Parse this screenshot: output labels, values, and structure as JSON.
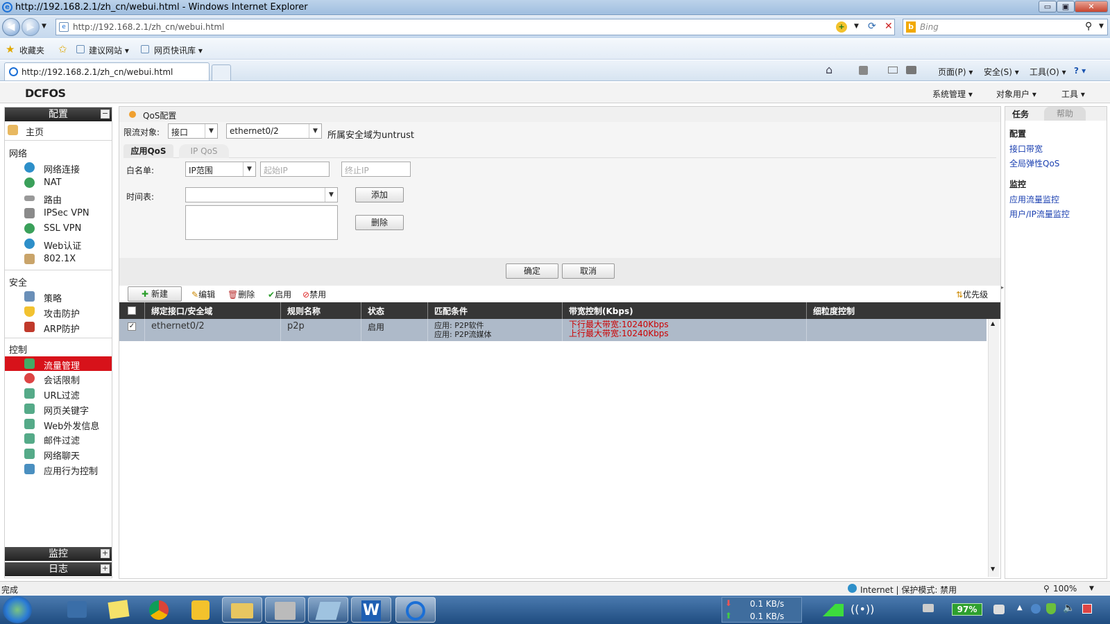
{
  "window": {
    "title": "http://192.168.2.1/zh_cn/webui.html - Windows Internet Explorer",
    "min": "▭",
    "max": "▣",
    "close": "✕"
  },
  "browser": {
    "url": "http://192.168.2.1/zh_cn/webui.html",
    "search_placeholder": "Bing",
    "favorites_label": "收藏夹",
    "fav_links": [
      "建议网站 ▾",
      "网页快讯库 ▾"
    ],
    "tab_title": "http://192.168.2.1/zh_cn/webui.html",
    "commands": [
      "页面(P) ▾",
      "安全(S) ▾",
      "工具(O) ▾",
      "? ▾"
    ]
  },
  "app": {
    "logo": "DCFOS",
    "menus": [
      "系统管理 ▾",
      "对象用户 ▾",
      "工具 ▾"
    ]
  },
  "sidebar": {
    "config_header": "配置",
    "home": "主页",
    "sections": [
      {
        "title": "网络",
        "items": [
          "网络连接",
          "NAT",
          "路由",
          "IPSec VPN",
          "SSL VPN",
          "Web认证",
          "802.1X"
        ]
      },
      {
        "title": "安全",
        "items": [
          "策略",
          "攻击防护",
          "ARP防护"
        ]
      },
      {
        "title": "控制",
        "items": [
          "流量管理",
          "会话限制",
          "URL过滤",
          "网页关键字",
          "Web外发信息",
          "邮件过滤",
          "网络聊天",
          "应用行为控制"
        ]
      }
    ],
    "active_item": "流量管理",
    "monitor_header": "监控",
    "log_header": "日志",
    "expand": "+",
    "collapse": "−"
  },
  "main": {
    "title": "QoS配置",
    "limit_label": "限流对象:",
    "limit_type": "接口",
    "limit_iface": "ethernet0/2",
    "zone_note": "所属安全域为untrust",
    "tabs": [
      "应用QoS",
      "IP QoS"
    ],
    "whitelist_label": "白名单:",
    "whitelist_type": "IP范围",
    "start_ip_placeholder": "起始IP",
    "end_ip_placeholder": "终止IP",
    "schedule_label": "时间表:",
    "schedule_value": "",
    "add_btn": "添加",
    "delete_btn": "删除",
    "ok_btn": "确定",
    "cancel_btn": "取消",
    "toolbar": {
      "new": "新建",
      "edit": "编辑",
      "delete": "删除",
      "enable": "启用",
      "disable": "禁用",
      "priority": "优先级"
    },
    "columns": [
      "绑定接口/安全域",
      "规则名称",
      "状态",
      "匹配条件",
      "带宽控制(Kbps)",
      "细粒度控制"
    ],
    "rows": [
      {
        "checked": true,
        "iface": "ethernet0/2",
        "name": "p2p",
        "status": "启用",
        "match": [
          "应用: P2P软件",
          "应用: P2P流媒体"
        ],
        "bandwidth": [
          "下行最大带宽:10240Kbps",
          "上行最大带宽:10240Kbps"
        ],
        "fine": ""
      }
    ]
  },
  "right_panel": {
    "tabs": [
      "任务",
      "帮助"
    ],
    "config_title": "配置",
    "config_links": [
      "接口带宽",
      "全局弹性QoS"
    ],
    "monitor_title": "监控",
    "monitor_links": [
      "应用流量监控",
      "用户/IP流量监控"
    ]
  },
  "statusbar": {
    "left": "完成",
    "zone": "Internet | 保护模式: 禁用",
    "zoom": "100%"
  },
  "taskbar": {
    "down_rate": "0.1 KB/s",
    "up_rate": "0.1 KB/s",
    "battery": "97%"
  },
  "colors": {
    "active_red": "#d7121a",
    "link_blue": "#1a3fb0",
    "bandwidth_red": "#cc0000",
    "header_dark": "#363636"
  }
}
